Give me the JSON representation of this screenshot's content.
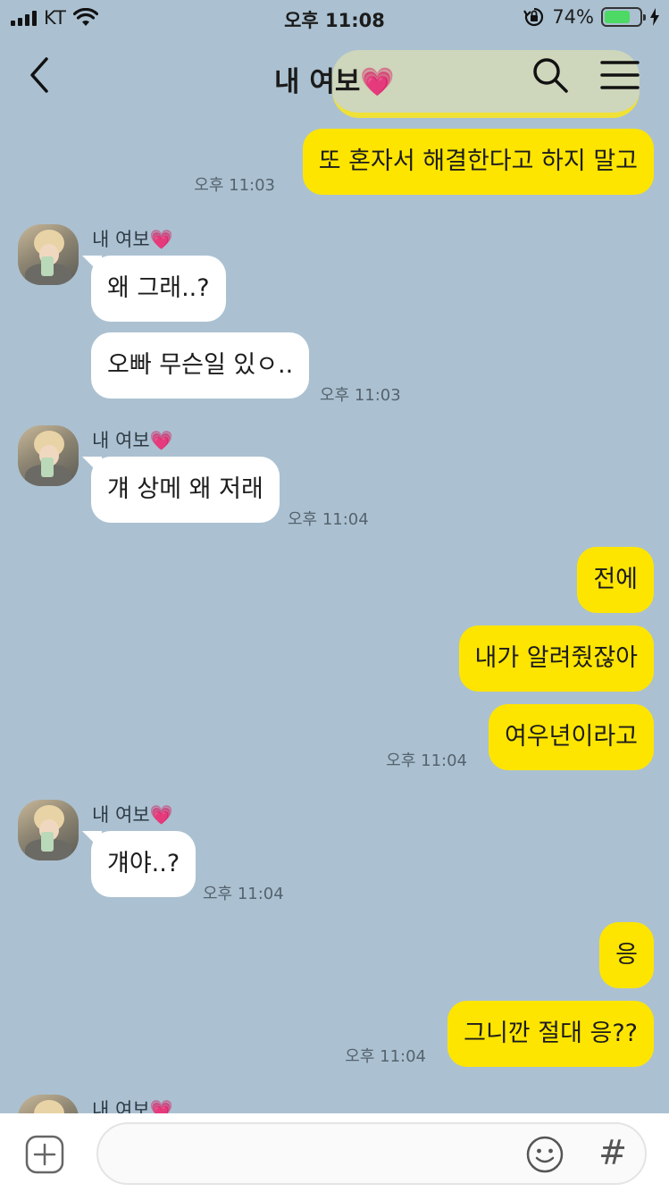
{
  "status_bar": {
    "carrier": "KT",
    "time": "오후 11:08",
    "battery_percent": "74%",
    "battery_level": 0.74,
    "battery_color": "#4cd964"
  },
  "header": {
    "title": "내 여보💗",
    "back_icon": "chevron-left-icon",
    "search_icon": "search-icon",
    "menu_icon": "hamburger-menu-icon"
  },
  "chat": {
    "sender_name": "내 여보💗",
    "messages": [
      {
        "from": "me",
        "text": "또 혼자서 해결한다고 하지 말고",
        "time": "오후 11:03"
      },
      {
        "from": "them",
        "text": "왜 그래..?"
      },
      {
        "from": "them",
        "text": "오빠 무슨일 있ㅇ..",
        "time": "오후 11:03"
      },
      {
        "from": "them",
        "text": "걔 상메 왜 저래",
        "time": "오후 11:04"
      },
      {
        "from": "me",
        "text": "전에"
      },
      {
        "from": "me",
        "text": "내가 알려줬잖아"
      },
      {
        "from": "me",
        "text": "여우년이라고",
        "time": "오후 11:04"
      },
      {
        "from": "them",
        "text": "걔야..?",
        "time": "오후 11:04"
      },
      {
        "from": "me",
        "text": "응"
      },
      {
        "from": "me",
        "text": "그니깐 절대 응??",
        "time": "오후 11:04"
      }
    ]
  },
  "input_bar": {
    "placeholder": "",
    "plus_icon": "plus-icon",
    "emoji_icon": "emoji-icon",
    "hash_label": "#"
  },
  "colors": {
    "background": "#abc1d1",
    "my_bubble": "#fee500",
    "their_bubble": "#ffffff"
  }
}
